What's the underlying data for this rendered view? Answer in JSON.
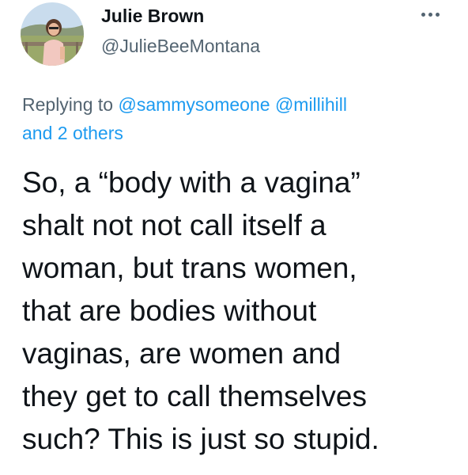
{
  "author": {
    "display_name": "Julie Brown",
    "handle": "@JulieBeeMontana",
    "avatar_icon": "profile-photo"
  },
  "more_icon": "more-dots-icon",
  "reply_context": {
    "prefix": "Replying to",
    "mentions": [
      "@sammysomeone",
      "@millihill"
    ],
    "others": "and 2 others"
  },
  "tweet": {
    "lines": [
      "So, a “body with a vagina”",
      "shalt not not call itself a",
      "woman, but trans women,",
      "that are bodies without",
      "vaginas, are women and",
      "they get to call themselves",
      "such? This is just so stupid."
    ]
  },
  "colors": {
    "text": "#0f1419",
    "secondary": "#536471",
    "link": "#1d9bf0",
    "background": "#ffffff"
  }
}
